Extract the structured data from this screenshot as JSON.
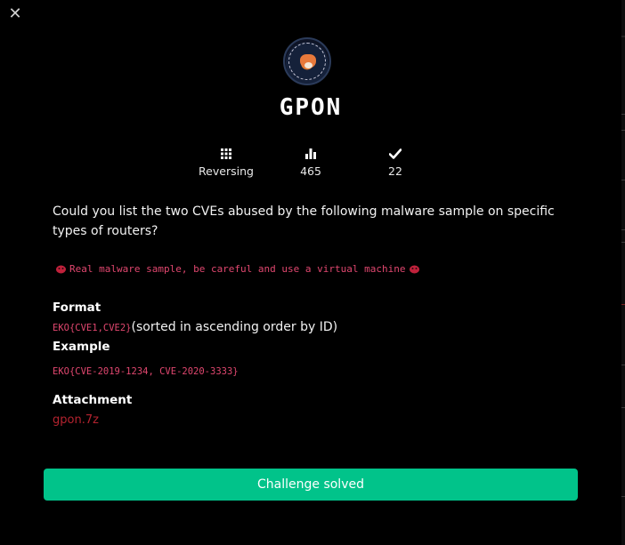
{
  "modal": {
    "close_symbol": "✕",
    "title": "GPON"
  },
  "stats": {
    "category": "Reversing",
    "points": "465",
    "solves": "22"
  },
  "description": "Could you list the two CVEs abused by the following malware sample on specific types of routers?",
  "warning": "Real malware sample, be careful and use a virtual machine",
  "format": {
    "heading": "Format",
    "code": "EKO{CVE1,CVE2}",
    "note": "(sorted in ascending order by ID)"
  },
  "example": {
    "heading": "Example",
    "code": "EKO{CVE-2019-1234, CVE-2020-3333}"
  },
  "attachment": {
    "heading": "Attachment",
    "file": "gpon.7z"
  },
  "solved_button": "Challenge solved",
  "colors": {
    "background": "#000000",
    "accent_green": "#01c38a",
    "code_pink": "#e0476f",
    "link_red": "#b4232f"
  }
}
